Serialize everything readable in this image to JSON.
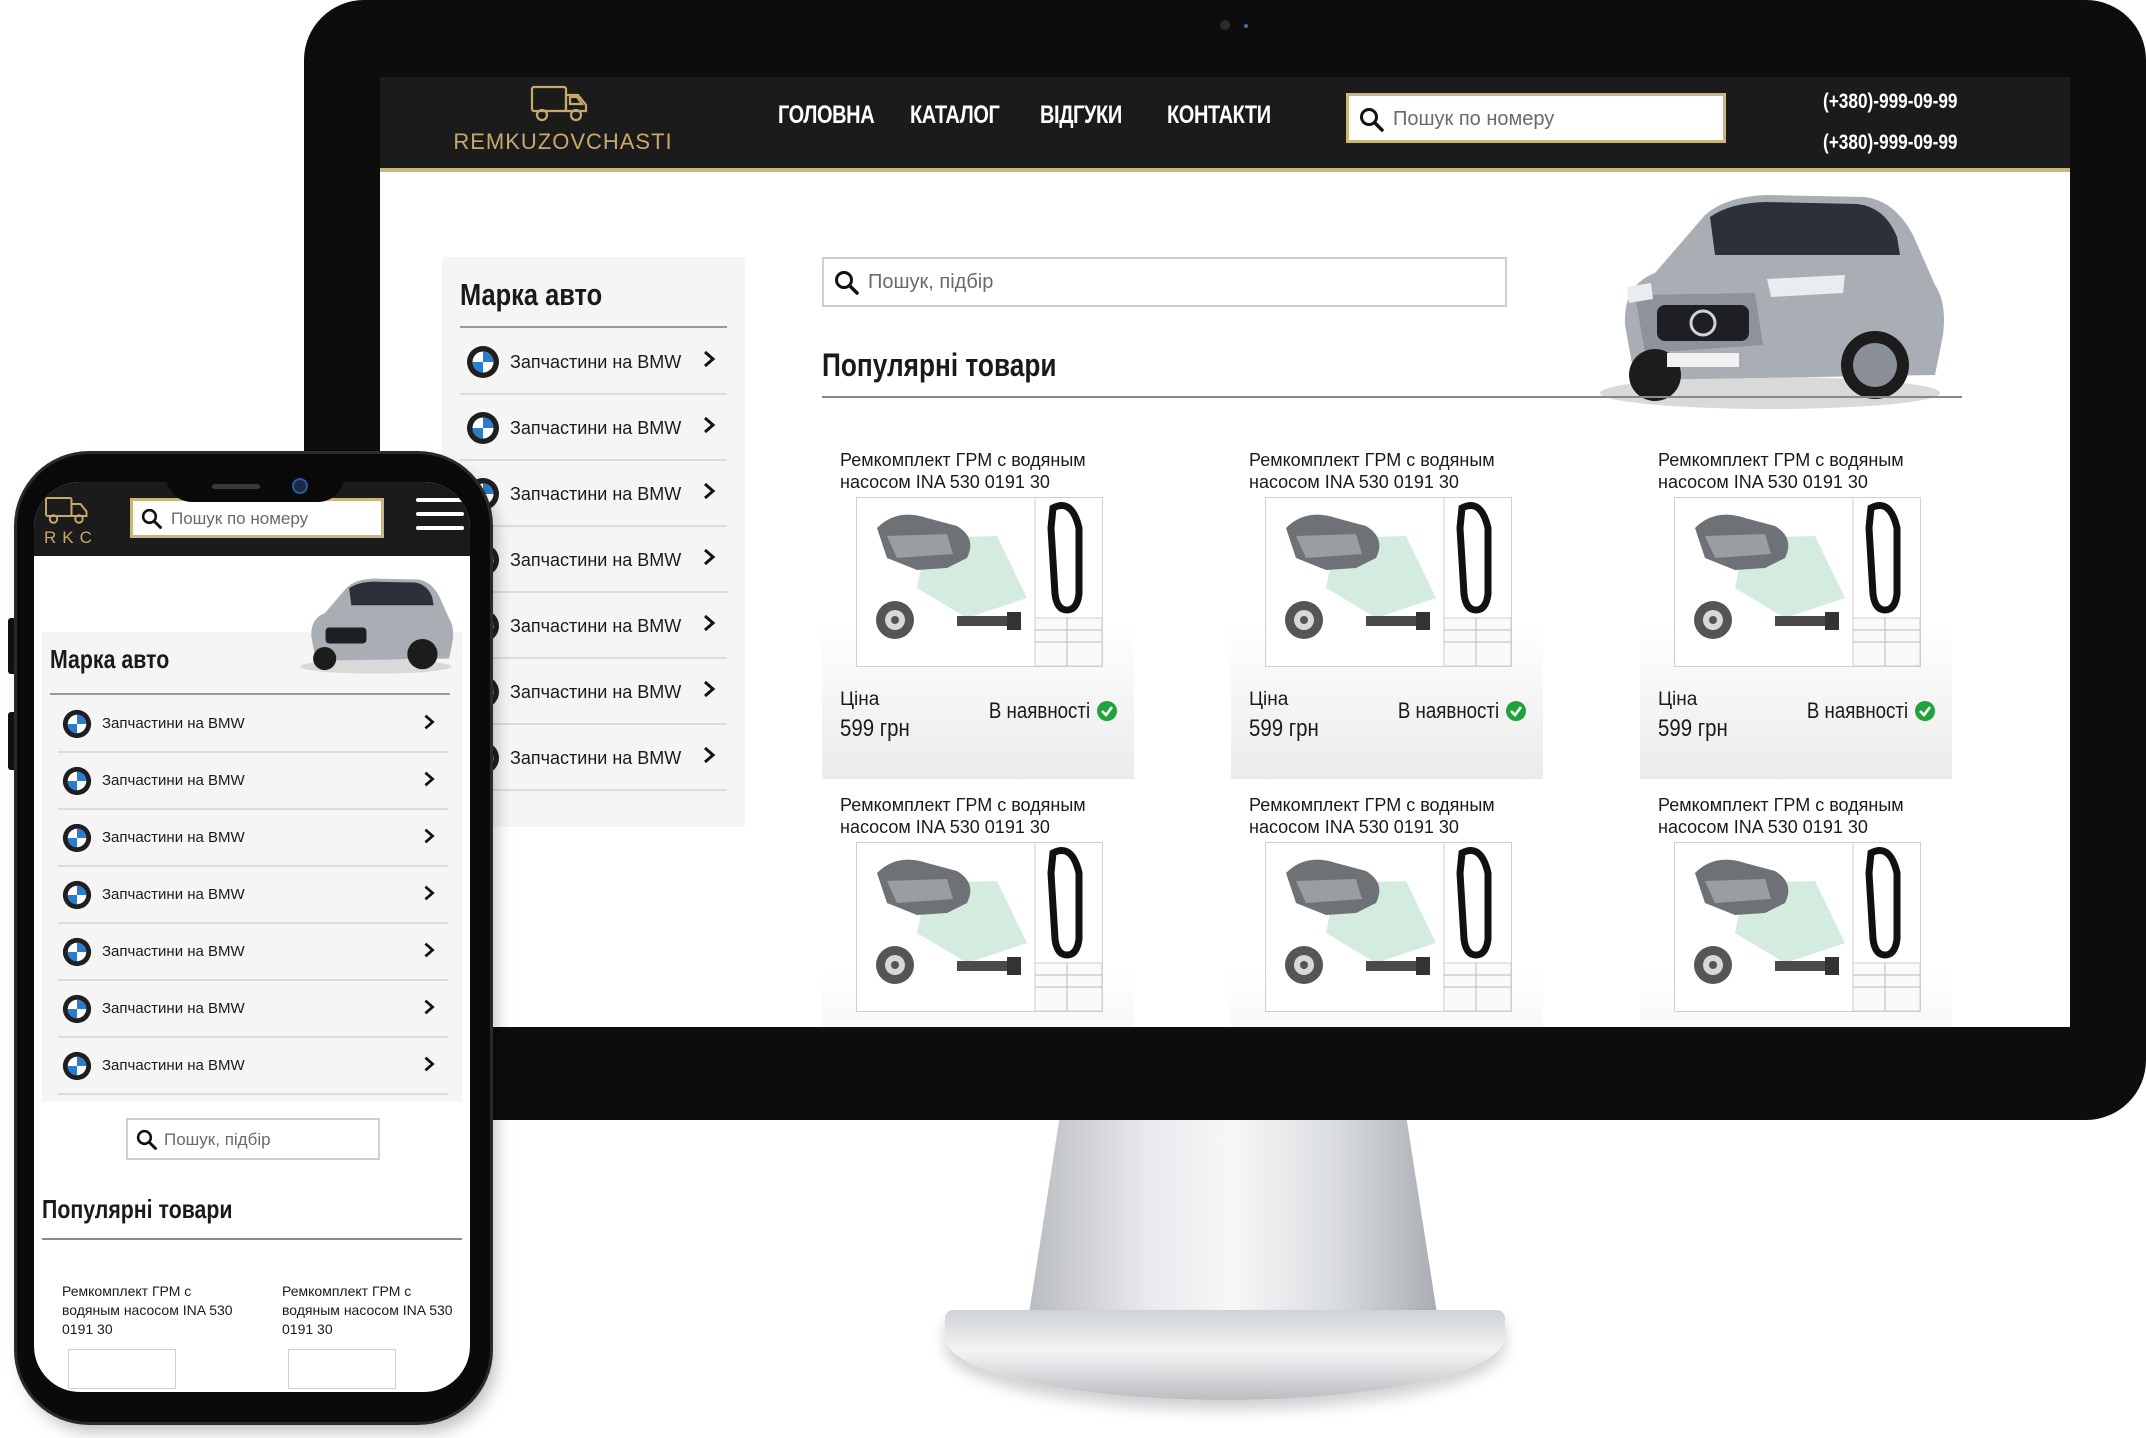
{
  "site": {
    "logo_text": "REMKUZOVCHASTI",
    "nav": [
      "ГОЛОВНА",
      "КАТАЛОГ",
      "ВІДГУКИ",
      "КОНТАКТИ"
    ],
    "header_search_placeholder": "Пошук по номеру",
    "phones": [
      "(+380)-999-09-99",
      "(+380)-999-09-99"
    ],
    "sidebar_title": "Марка авто",
    "sidebar_items": [
      "Запчастини на BMW",
      "Запчастини на BMW",
      "Запчастини на BMW",
      "Запчастини на BMW",
      "Запчастини на BMW",
      "Запчастини на BMW",
      "Запчастини на BMW"
    ],
    "main_search_placeholder": "Пошук, підбір",
    "popular_title": "Популярні товари",
    "products": [
      {
        "name": "Ремкомплект ГРМ с водяным насосом INA 530 0191 30",
        "price_label": "Ціна",
        "price": "599 грн",
        "stock": "В наявності"
      },
      {
        "name": "Ремкомплект ГРМ с водяным насосом INA 530 0191 30",
        "price_label": "Ціна",
        "price": "599 грн",
        "stock": "В наявності"
      },
      {
        "name": "Ремкомплект ГРМ с водяным насосом INA 530 0191 30",
        "price_label": "Ціна",
        "price": "599 грн",
        "stock": "В наявності"
      },
      {
        "name": "Ремкомплект ГРМ с водяным насосом INA 530 0191 30"
      },
      {
        "name": "Ремкомплект ГРМ с водяным насосом INA 530 0191 30"
      },
      {
        "name": "Ремкомплект ГРМ с водяным насосом INA 530 0191 30"
      }
    ]
  },
  "mobile": {
    "logo_text": "RKC",
    "search_placeholder": "Пошук по номеру",
    "brand_title": "Марка авто",
    "brand_items": [
      "Запчастини на BMW",
      "Запчастини на BMW",
      "Запчастини на BMW",
      "Запчастини на BMW",
      "Запчастини на BMW",
      "Запчастини на BMW",
      "Запчастини на BMW"
    ],
    "search2_placeholder": "Пошук, підбір",
    "popular_title": "Популярні товари",
    "products": [
      {
        "name": "Ремкомплект ГРМ с водяным насосом INA 530 0191 30"
      },
      {
        "name": "Ремкомплект ГРМ с водяным насосом INA 530 0191 30"
      }
    ]
  },
  "colors": {
    "header_bg": "#1b1b1b",
    "accent_gold": "#c8b67a",
    "logo_gold": "#c9a96a",
    "stock_green": "#1fa33a"
  },
  "icons": [
    "truck-logo-icon",
    "search-icon",
    "bmw-logo-icon",
    "chevron-right-icon",
    "check-circle-icon",
    "hamburger-menu-icon"
  ]
}
